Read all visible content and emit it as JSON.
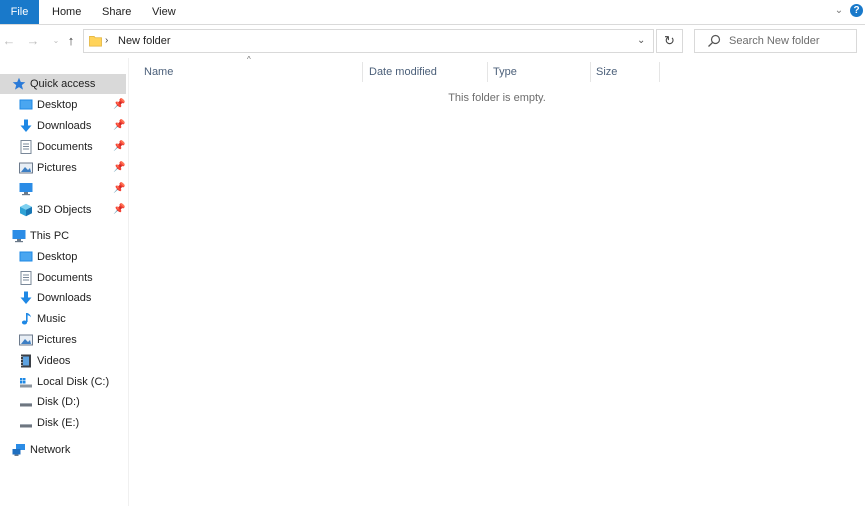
{
  "ribbon": {
    "tabs": [
      "File",
      "Home",
      "Share",
      "View"
    ],
    "help_label": "?"
  },
  "addressbar": {
    "breadcrumb": "New folder",
    "search_placeholder": "Search New folder"
  },
  "navpane": {
    "quick_access": {
      "label": "Quick access",
      "items": [
        {
          "label": "Desktop",
          "icon": "desktop-icon",
          "pinned": true
        },
        {
          "label": "Downloads",
          "icon": "download-arrow-icon",
          "pinned": true
        },
        {
          "label": "Documents",
          "icon": "documents-icon",
          "pinned": true
        },
        {
          "label": "Pictures",
          "icon": "pictures-icon",
          "pinned": true
        },
        {
          "label": "",
          "icon": "monitor-icon",
          "pinned": true
        },
        {
          "label": "3D Objects",
          "icon": "3d-objects-icon",
          "pinned": true
        }
      ]
    },
    "this_pc": {
      "label": "This PC",
      "items": [
        {
          "label": "Desktop",
          "icon": "desktop-icon"
        },
        {
          "label": "Documents",
          "icon": "documents-icon"
        },
        {
          "label": "Downloads",
          "icon": "download-arrow-icon"
        },
        {
          "label": "Music",
          "icon": "music-icon"
        },
        {
          "label": "Pictures",
          "icon": "pictures-icon"
        },
        {
          "label": "Videos",
          "icon": "videos-icon"
        },
        {
          "label": "Local Disk (C:)",
          "icon": "local-disk-icon"
        },
        {
          "label": "Disk (D:)",
          "icon": "disk-icon"
        },
        {
          "label": "Disk (E:)",
          "icon": "disk-icon"
        }
      ]
    },
    "network": {
      "label": "Network"
    }
  },
  "content": {
    "columns": [
      "Name",
      "Date modified",
      "Type",
      "Size"
    ],
    "empty_message": "This folder is empty."
  },
  "colors": {
    "accent": "#1979ca",
    "selection": "#d9d9d9",
    "header_text": "#4c607a"
  }
}
